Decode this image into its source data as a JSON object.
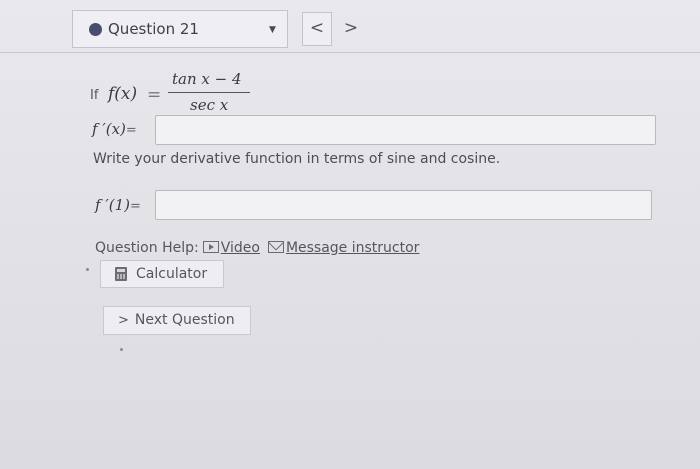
{
  "question_selector": {
    "label": "Question 21",
    "caret": "▼"
  },
  "nav": {
    "prev": "<",
    "next": ">"
  },
  "problem": {
    "if_text": "If",
    "function_lhs": "f(x)",
    "equals": "=",
    "numerator": "tan x − 4",
    "denominator": "sec x",
    "part1_label": "f ′(x)",
    "part1_equals": "=",
    "part1_value": "",
    "instruction": "Write your derivative function in terms of sine and cosine.",
    "part2_label": "f ′(1)",
    "part2_equals": "=",
    "part2_value": ""
  },
  "help": {
    "label": "Question Help:",
    "video": "Video",
    "message": "Message instructor"
  },
  "calculator": {
    "label": "Calculator"
  },
  "next_question": {
    "chevron": ">",
    "label": "Next Question"
  }
}
